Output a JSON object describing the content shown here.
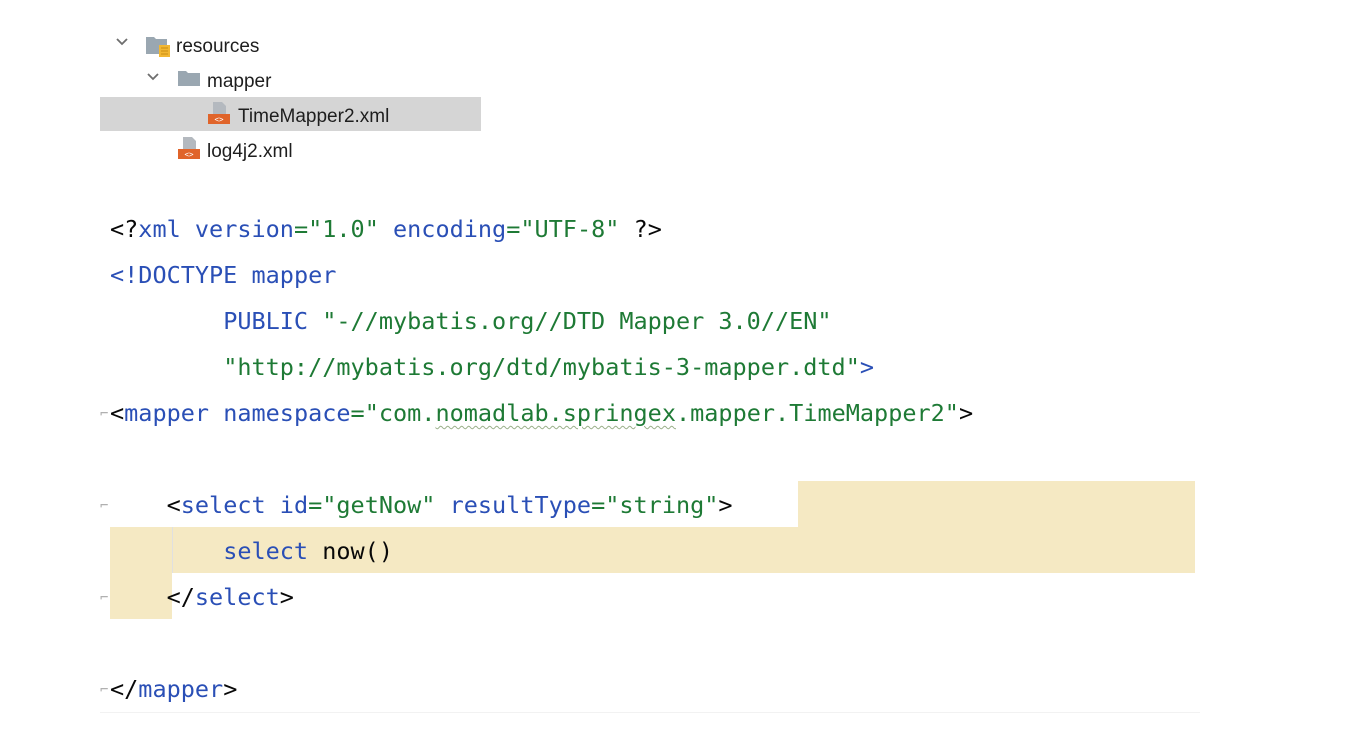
{
  "project_tree": {
    "items": [
      {
        "label": "resources",
        "type": "resources-folder",
        "expanded": true
      },
      {
        "label": "mapper",
        "type": "folder",
        "expanded": true
      },
      {
        "label": "TimeMapper2.xml",
        "type": "xml-file",
        "selected": true
      },
      {
        "label": "log4j2.xml",
        "type": "xml-file",
        "selected": false
      }
    ]
  },
  "editor": {
    "line1": {
      "open": "<?",
      "tag": "xml",
      "attr1": "version",
      "eq1": "=",
      "val1": "\"1.0\"",
      "attr2": "encoding",
      "eq2": "=",
      "val2": "\"UTF-8\"",
      "close": "?>"
    },
    "line2": {
      "open": "<!",
      "kw": "DOCTYPE",
      "name": "mapper"
    },
    "line3": {
      "kw": "PUBLIC",
      "str": "\"-//mybatis.org//DTD Mapper 3.0//EN\""
    },
    "line4": {
      "str": "\"http://mybatis.org/dtd/mybatis-3-mapper.dtd\"",
      "close": ">"
    },
    "line5": {
      "open": "<",
      "tag": "mapper",
      "attr": "namespace",
      "eq": "=",
      "q1": "\"com.",
      "squiggle": "nomadlab.springex",
      "rest": ".mapper.TimeMapper2\"",
      "close": ">"
    },
    "line6": {
      "open": "<",
      "tag": "select",
      "attr1": "id",
      "eq1": "=",
      "val1": "\"getNow\"",
      "attr2": "resultType",
      "eq2": "=",
      "val2": "\"string\"",
      "close": ">"
    },
    "line7": {
      "kw": "select",
      "text": "now()"
    },
    "line8": {
      "open": "</",
      "tag": "select",
      "close": ">"
    },
    "line9": {
      "open": "</",
      "tag": "mapper",
      "close": ">"
    }
  },
  "colors": {
    "tag_blue": "#2a4fb6",
    "string_green": "#1e7a35",
    "highlight": "#f5e9c3",
    "selection_gray": "#d5d5d5"
  }
}
